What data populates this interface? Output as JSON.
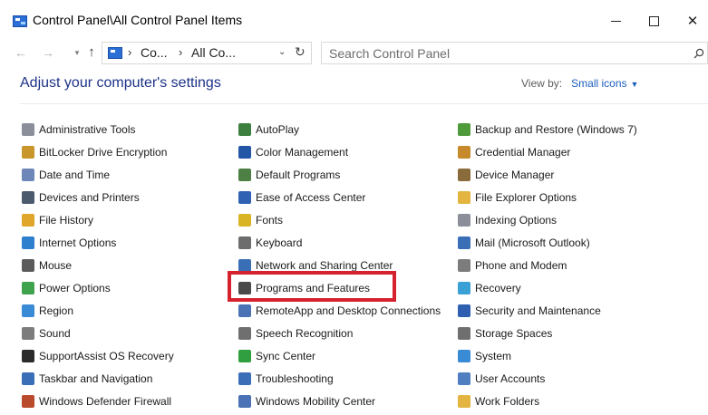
{
  "window": {
    "title": "Control Panel\\All Control Panel Items"
  },
  "address": {
    "segments": [
      "Co...",
      "All Co..."
    ],
    "search_placeholder": "Search Control Panel"
  },
  "header": {
    "heading": "Adjust your computer's settings",
    "view_by_label": "View by:",
    "view_by_value": "Small icons"
  },
  "columns": [
    [
      {
        "label": "Administrative Tools",
        "icon": "admin-tools-icon",
        "color": "#8a8f99"
      },
      {
        "label": "BitLocker Drive Encryption",
        "icon": "bitlocker-icon",
        "color": "#c9962b"
      },
      {
        "label": "Date and Time",
        "icon": "clock-icon",
        "color": "#6d88b8"
      },
      {
        "label": "Devices and Printers",
        "icon": "printer-icon",
        "color": "#4c5a6e"
      },
      {
        "label": "File History",
        "icon": "file-history-icon",
        "color": "#e0a52b"
      },
      {
        "label": "Internet Options",
        "icon": "globe-icon",
        "color": "#2f7fcf"
      },
      {
        "label": "Mouse",
        "icon": "mouse-icon",
        "color": "#5b5b5b"
      },
      {
        "label": "Power Options",
        "icon": "power-icon",
        "color": "#3fa34d"
      },
      {
        "label": "Region",
        "icon": "region-icon",
        "color": "#3a8bd6"
      },
      {
        "label": "Sound",
        "icon": "speaker-icon",
        "color": "#7c7c7c"
      },
      {
        "label": "SupportAssist OS Recovery",
        "icon": "support-assist-icon",
        "color": "#2b2b2b"
      },
      {
        "label": "Taskbar and Navigation",
        "icon": "taskbar-icon",
        "color": "#3a6fb7"
      },
      {
        "label": "Windows Defender Firewall",
        "icon": "firewall-icon",
        "color": "#b94a2c"
      }
    ],
    [
      {
        "label": "AutoPlay",
        "icon": "autoplay-icon",
        "color": "#3d7f3f"
      },
      {
        "label": "Color Management",
        "icon": "monitor-icon",
        "color": "#2456a8"
      },
      {
        "label": "Default Programs",
        "icon": "default-programs-icon",
        "color": "#4e7f45"
      },
      {
        "label": "Ease of Access Center",
        "icon": "ease-of-access-icon",
        "color": "#2f62b3"
      },
      {
        "label": "Fonts",
        "icon": "fonts-icon",
        "color": "#d9b526"
      },
      {
        "label": "Keyboard",
        "icon": "keyboard-icon",
        "color": "#6d6d6d"
      },
      {
        "label": "Network and Sharing Center",
        "icon": "network-icon",
        "color": "#3a6fb7"
      },
      {
        "label": "Programs and Features",
        "icon": "programs-icon",
        "color": "#4a4a4a"
      },
      {
        "label": "RemoteApp and Desktop Connections",
        "icon": "remoteapp-icon",
        "color": "#4a72b5"
      },
      {
        "label": "Speech Recognition",
        "icon": "microphone-icon",
        "color": "#6f6f6f"
      },
      {
        "label": "Sync Center",
        "icon": "sync-icon",
        "color": "#2f9f3f"
      },
      {
        "label": "Troubleshooting",
        "icon": "troubleshooting-icon",
        "color": "#3a6fb7"
      },
      {
        "label": "Windows Mobility Center",
        "icon": "mobility-center-icon",
        "color": "#4a72b5"
      }
    ],
    [
      {
        "label": "Backup and Restore (Windows 7)",
        "icon": "backup-icon",
        "color": "#4f9a3b"
      },
      {
        "label": "Credential Manager",
        "icon": "credential-icon",
        "color": "#c68a2c"
      },
      {
        "label": "Device Manager",
        "icon": "device-manager-icon",
        "color": "#8a6b3b"
      },
      {
        "label": "File Explorer Options",
        "icon": "folder-options-icon",
        "color": "#e3b440"
      },
      {
        "label": "Indexing Options",
        "icon": "indexing-icon",
        "color": "#8a8f99"
      },
      {
        "label": "Mail (Microsoft Outlook)",
        "icon": "mail-icon",
        "color": "#3a6fb7"
      },
      {
        "label": "Phone and Modem",
        "icon": "phone-icon",
        "color": "#7c7c7c"
      },
      {
        "label": "Recovery",
        "icon": "recovery-icon",
        "color": "#3aa0d6"
      },
      {
        "label": "Security and Maintenance",
        "icon": "flag-icon",
        "color": "#2f5fb0"
      },
      {
        "label": "Storage Spaces",
        "icon": "storage-icon",
        "color": "#6f6f6f"
      },
      {
        "label": "System",
        "icon": "system-icon",
        "color": "#3a8bd6"
      },
      {
        "label": "User Accounts",
        "icon": "user-accounts-icon",
        "color": "#4f7fc0"
      },
      {
        "label": "Work Folders",
        "icon": "work-folders-icon",
        "color": "#e3b440"
      }
    ]
  ],
  "highlight_color": "#d6212e"
}
